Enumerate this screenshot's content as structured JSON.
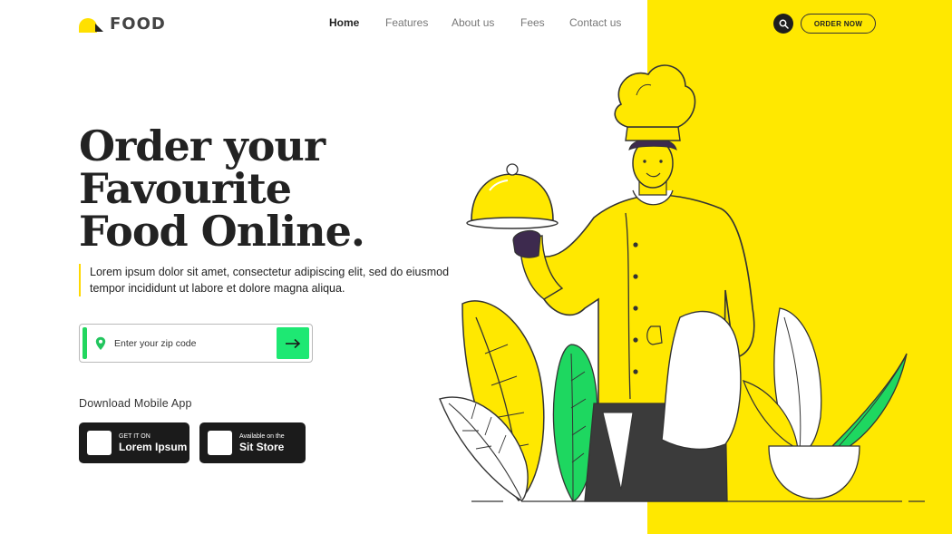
{
  "brand": {
    "name": "FOOD",
    "accent": "#ffe800",
    "green": "#1ee873"
  },
  "nav": {
    "items": [
      {
        "label": "Home",
        "active": true
      },
      {
        "label": "Features",
        "active": false
      },
      {
        "label": "About us",
        "active": false
      },
      {
        "label": "Fees",
        "active": false
      },
      {
        "label": "Contact us",
        "active": false
      }
    ],
    "search_icon": "search-icon",
    "order_label": "ORDER NOW"
  },
  "hero": {
    "headline": [
      "Order your",
      "Favourite",
      "Food Online."
    ],
    "description": "Lorem ipsum dolor sit amet, consectetur adipiscing elit, sed do eiusmod tempor incididunt ut labore et dolore magna aliqua.",
    "zip": {
      "placeholder": "Enter your zip code",
      "value": "",
      "icon": "location-pin-icon",
      "submit_icon": "arrow-right-icon"
    }
  },
  "download": {
    "label": "Download Mobile App",
    "stores": [
      {
        "small": "GET IT ON",
        "big": "Lorem Ipsum"
      },
      {
        "small": "Available on the",
        "big": "Sit Store"
      }
    ]
  },
  "illustration": {
    "subject": "chef-holding-cloche-illustration"
  }
}
